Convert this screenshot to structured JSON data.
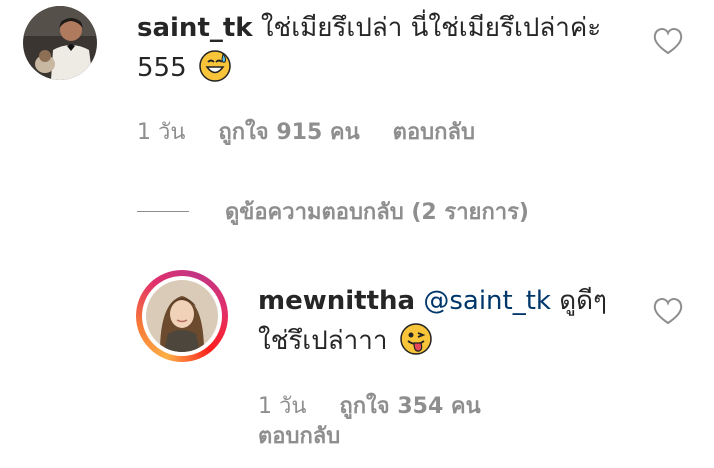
{
  "comment": {
    "username": "saint_tk",
    "text": "ใช่เมียรึเปล่า นี่ใช่เมียรึเปล่าค่ะ 555",
    "emoji": "grinning-face-with-sweat-emoji",
    "time": "1 วัน",
    "likes": "ถูกใจ 915 คน",
    "reply_label": "ตอบกลับ"
  },
  "view_replies": {
    "label": "ดูข้อความตอบกลับ (2 รายการ)"
  },
  "reply": {
    "username": "mewnittha",
    "mention": "@saint_tk",
    "text": "ดูดีๆ ใช่รึเปล่าาา",
    "emoji": "face-with-tongue-emoji",
    "time": "1 วัน",
    "likes": "ถูกใจ 354 คน",
    "reply_label": "ตอบกลับ"
  },
  "colors": {
    "text": "#262626",
    "secondary": "#8e8e8e",
    "mention": "#00376b",
    "emoji_yellow": "#f8c53a"
  },
  "icons": {
    "like": "heart-outline-icon"
  }
}
